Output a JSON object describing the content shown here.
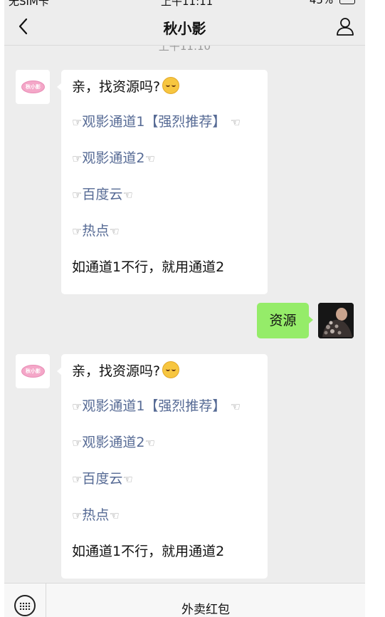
{
  "status_bar": {
    "carrier": "无SIM卡",
    "time": "上午11:11",
    "battery": "45%"
  },
  "nav": {
    "title": "秋小影"
  },
  "timestamp": "上午11:10",
  "messages": [
    {
      "sender": "left",
      "avatar_text": "秋小影",
      "first_line": "亲，找资源吗?",
      "links": [
        "观影通道1【强烈推荐】",
        "观影通道2",
        "百度云",
        "热点"
      ],
      "footer": "如通道1不行，就用通道2"
    },
    {
      "sender": "right",
      "text": "资源"
    },
    {
      "sender": "left",
      "avatar_text": "秋小影",
      "first_line": "亲，找资源吗?",
      "links": [
        "观影通道1【强烈推荐】",
        "观影通道2",
        "百度云",
        "热点"
      ],
      "footer": "如通道1不行，就用通道2"
    }
  ],
  "hand_left": "☞",
  "hand_right": "☜",
  "bottom_menu": {
    "item": "外卖红包"
  }
}
